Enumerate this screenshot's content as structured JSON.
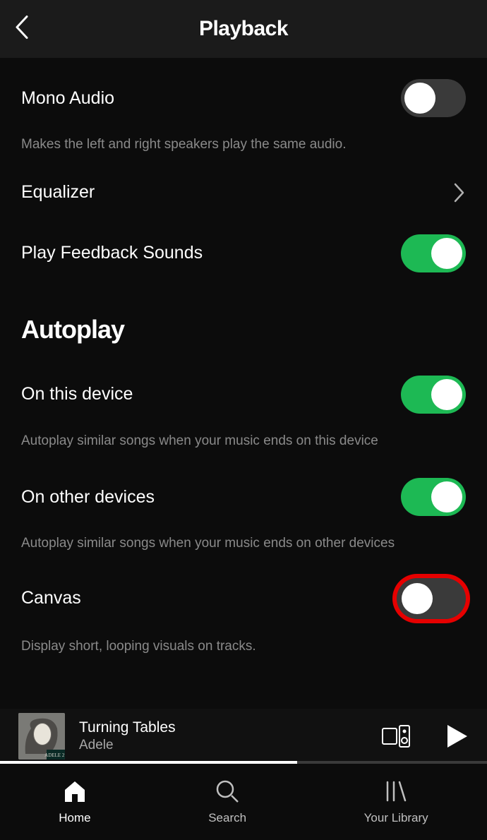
{
  "header": {
    "title": "Playback"
  },
  "settings": {
    "mono": {
      "label": "Mono Audio",
      "desc": "Makes the left and right speakers play the same audio.",
      "on": false
    },
    "equalizer": {
      "label": "Equalizer"
    },
    "feedback": {
      "label": "Play Feedback Sounds",
      "on": true
    },
    "autoplay_section": "Autoplay",
    "on_this_device": {
      "label": "On this device",
      "desc": "Autoplay similar songs when your music ends on this device",
      "on": true
    },
    "on_other": {
      "label": "On other devices",
      "desc": "Autoplay similar songs when your music ends on other devices",
      "on": true
    },
    "canvas": {
      "label": "Canvas",
      "desc": "Display short, looping visuals on tracks.",
      "on": false
    }
  },
  "now_playing": {
    "title": "Turning Tables",
    "artist": "Adele",
    "progress_pct": 61
  },
  "tabs": {
    "home": "Home",
    "search": "Search",
    "library": "Your Library"
  },
  "colors": {
    "accent": "#1db954",
    "highlight": "#e60000"
  }
}
